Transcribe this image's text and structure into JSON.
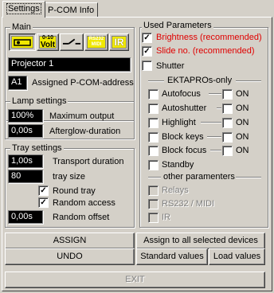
{
  "tabs": [
    {
      "label": "Settings"
    },
    {
      "label": "P-COM Info"
    }
  ],
  "main": {
    "title": "Main",
    "icons": [
      "projector-icon",
      "volt-icon",
      "switch-icon",
      "multi-icon",
      "ir-icon"
    ],
    "icon_texts": {
      "volt_top": "0-10",
      "volt": "Volt",
      "multi_top": "RS232",
      "multi_bottom": "MIDI",
      "ir": "IR"
    },
    "projector_name": "Projector 1",
    "address_value": "A1",
    "address_label": "Assigned P-COM-address"
  },
  "lamp": {
    "title": "Lamp settings",
    "max_value": "100%",
    "max_label": "Maximum output",
    "afterglow_value": "0,00s",
    "afterglow_label": "Afterglow-duration"
  },
  "tray": {
    "title": "Tray settings",
    "transport_value": "1,00s",
    "transport_label": "Transport duration",
    "size_value": "80",
    "size_label": "tray size",
    "round_label": "Round tray",
    "random_access_label": "Random access",
    "offset_value": "0,00s",
    "offset_label": "Random offset"
  },
  "used": {
    "title": "Used Parameters",
    "brightness": "Brightness (recommended)",
    "slide_no": "Slide no. (recommended)",
    "shutter": "Shutter",
    "ekta_title": "EKTAPROs-only",
    "autofocus": "Autofocus",
    "autoshutter": "Autoshutter",
    "highlight": "Highlight",
    "block_keys": "Block keys",
    "block_focus": "Block focus",
    "standby": "Standby",
    "on": "ON",
    "other_title": "other paramenters",
    "relays": "Relays",
    "rs232": "RS232 / MIDI",
    "ir": "IR",
    "red_color": "#e00000"
  },
  "buttons": {
    "assign": "ASSIGN",
    "undo": "UNDO",
    "assign_all": "Assign to all selected devices",
    "standard": "Standard values",
    "load": "Load values",
    "exit": "EXIT"
  }
}
